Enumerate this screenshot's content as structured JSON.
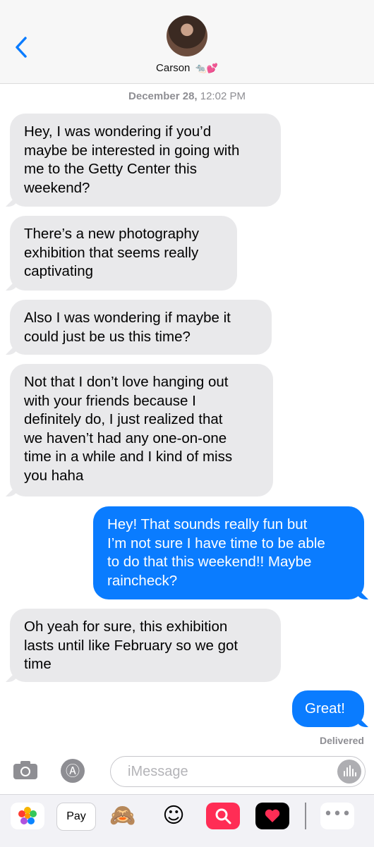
{
  "header": {
    "contact_name": "Carson",
    "contact_emoji": "🐀💕"
  },
  "timestamp": {
    "date": "December 28,",
    "time": "12:02 PM"
  },
  "messages": [
    {
      "direction": "incoming",
      "text": "Hey, I was wondering if you’d\nmaybe be interested in going with\nme to the Getty Center this\nweekend?"
    },
    {
      "direction": "incoming",
      "text": "There’s a new photography\nexhibition that seems really\ncaptivating"
    },
    {
      "direction": "incoming",
      "text": "Also I was wondering if maybe it\ncould just be us this time?"
    },
    {
      "direction": "incoming",
      "text": "Not that I don’t love hanging out\nwith your friends because I\ndefinitely do, I just realized that\nwe haven’t had any one-on-one\ntime in a while and I kind of miss\nyou haha"
    },
    {
      "direction": "outgoing",
      "text": "Hey! That sounds really fun but\nI’m not sure I have time to be able\nto do that this weekend!! Maybe\nraincheck?"
    },
    {
      "direction": "incoming",
      "text": "Oh yeah for sure, this exhibition\nlasts until like February so we got\ntime"
    },
    {
      "direction": "outgoing",
      "text": "Great!"
    }
  ],
  "status": {
    "delivered": "Delivered"
  },
  "compose": {
    "placeholder": "iMessage"
  },
  "apps": {
    "apple_pay": "Pay",
    "icons": [
      "photos-icon",
      "apple-pay-icon",
      "monkey-emoji-icon",
      "memoji-icon",
      "image-search-icon",
      "digital-touch-icon",
      "more-icon"
    ]
  },
  "colors": {
    "incoming": "#e9e9eb",
    "outgoing": "#0a7cff",
    "accent": "#0a7cff"
  }
}
